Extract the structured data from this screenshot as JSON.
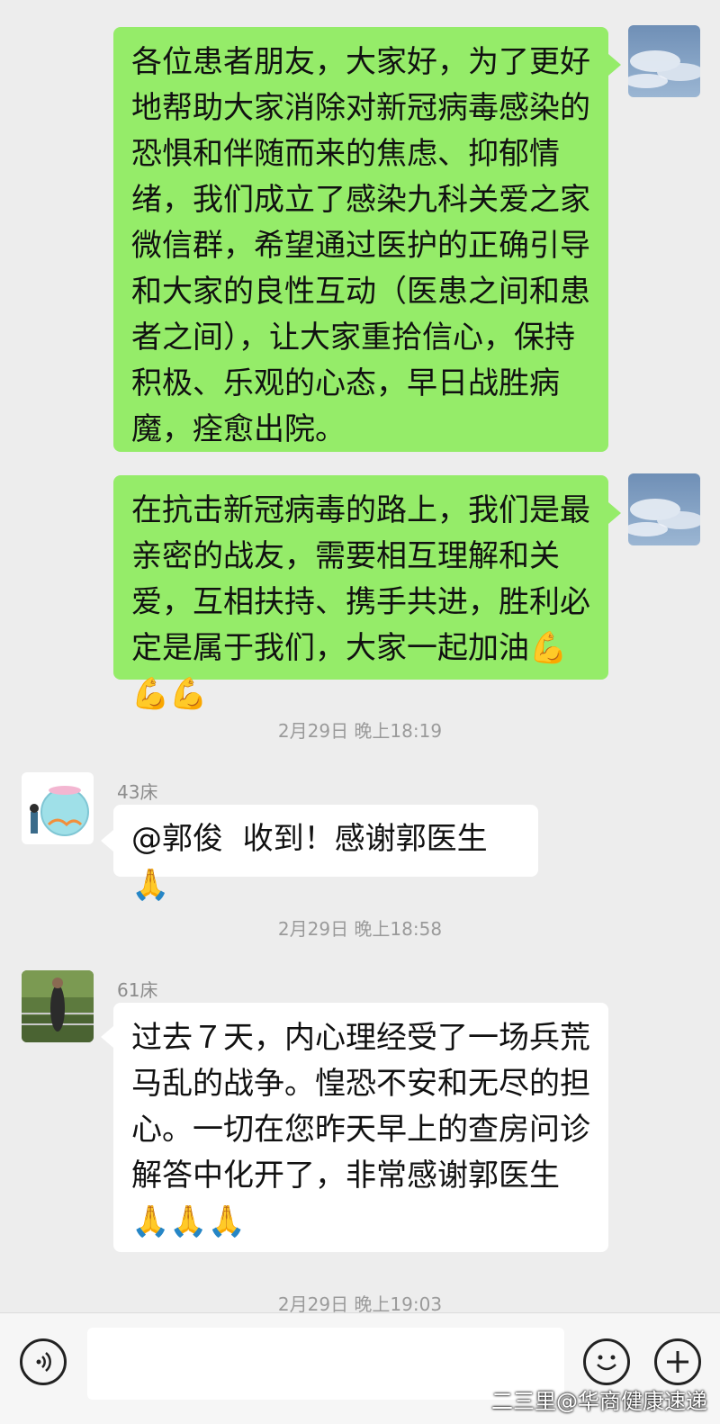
{
  "messages": {
    "m1": {
      "text": "各位患者朋友，大家好，为了更好地帮助大家消除对新冠病毒感染的恐惧和伴随而来的焦虑、抑郁情绪，我们成立了感染九科关爱之家微信群，希望通过医护的正确引导和大家的良性互动（医患之间和患者之间），让大家重拾信心，保持积极、乐观的心态，早日战胜病魔，痊愈出院。"
    },
    "m2": {
      "text": "在抗击新冠病毒的路上，我们是最亲密的战友，需要相互理解和关爱，互相扶持、携手共进，胜利必定是属于我们，大家一起加油",
      "emoji": "💪💪💪"
    },
    "ts1": "2月29日 晚上18:19",
    "m3": {
      "sender": "43床",
      "text": "@郭俊  收到！感谢郭医生",
      "emoji": "🙏"
    },
    "ts2": "2月29日 晚上18:58",
    "m4": {
      "sender": "61床",
      "text": "过去７天，内心理经受了一场兵荒马乱的战争。惶恐不安和无尽的担心。一切在您昨天早上的查房问诊解答中化开了，非常感谢郭医生",
      "emoji": "🙏🙏🙏"
    },
    "ts3": "2月29日 晚上19:03"
  },
  "watermark": "二三里@华商健康速递",
  "icons": {
    "voice": "voice-icon",
    "emoji": "smiley-icon",
    "plus": "plus-icon"
  },
  "colors": {
    "outgoing": "#95ec69",
    "incoming": "#ffffff",
    "background": "#ededed"
  }
}
